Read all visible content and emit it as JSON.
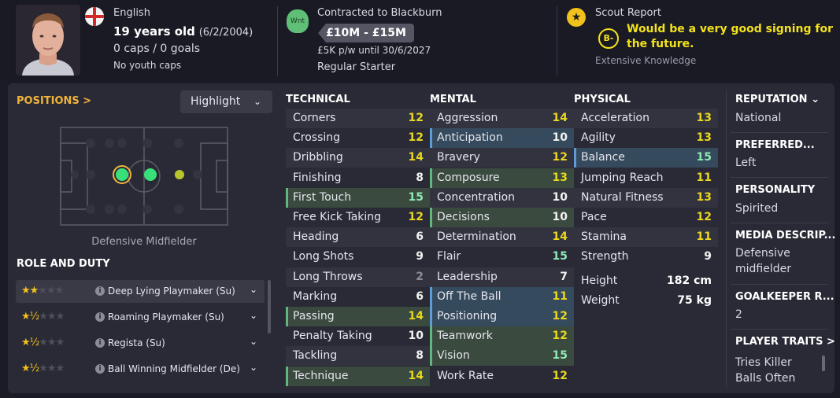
{
  "header": {
    "nationality": "English",
    "age": "19 years old",
    "dob": "(6/2/2004)",
    "caps": "0 caps / 0 goals",
    "youth_caps": "No youth caps",
    "wnt_badge": "Wnt",
    "contract": "Contracted to Blackburn",
    "value": "£10M - £15M",
    "wage": "£5K p/w until 30/6/2027",
    "squad_status": "Regular Starter",
    "scout_title": "Scout Report",
    "scout_grade": "B-",
    "scout_text": "Would be a very good signing for the future.",
    "scout_knowledge": "Extensive Knowledge"
  },
  "positions": {
    "link_label": "POSITIONS >",
    "view_select": "Highlight",
    "position_name": "Defensive Midfielder"
  },
  "roles": {
    "title": "ROLE AND DUTY",
    "items": [
      {
        "label": "Deep Lying Playmaker (Su)",
        "stars": 2,
        "selected": true
      },
      {
        "label": "Roaming Playmaker (Su)",
        "stars": 1.5,
        "selected": false
      },
      {
        "label": "Regista (Su)",
        "stars": 1.5,
        "selected": false
      },
      {
        "label": "Ball Winning Midfielder (De)",
        "stars": 1.5,
        "selected": false
      }
    ]
  },
  "technical": {
    "title": "TECHNICAL",
    "items": [
      {
        "name": "Corners",
        "value": "12"
      },
      {
        "name": "Crossing",
        "value": "12"
      },
      {
        "name": "Dribbling",
        "value": "14"
      },
      {
        "name": "Finishing",
        "value": "8"
      },
      {
        "name": "First Touch",
        "value": "15"
      },
      {
        "name": "Free Kick Taking",
        "value": "12"
      },
      {
        "name": "Heading",
        "value": "6"
      },
      {
        "name": "Long Shots",
        "value": "9"
      },
      {
        "name": "Long Throws",
        "value": "2"
      },
      {
        "name": "Marking",
        "value": "6"
      },
      {
        "name": "Passing",
        "value": "14"
      },
      {
        "name": "Penalty Taking",
        "value": "10"
      },
      {
        "name": "Tackling",
        "value": "8"
      },
      {
        "name": "Technique",
        "value": "14"
      }
    ]
  },
  "mental": {
    "title": "MENTAL",
    "items": [
      {
        "name": "Aggression",
        "value": "14"
      },
      {
        "name": "Anticipation",
        "value": "10"
      },
      {
        "name": "Bravery",
        "value": "12"
      },
      {
        "name": "Composure",
        "value": "13"
      },
      {
        "name": "Concentration",
        "value": "10"
      },
      {
        "name": "Decisions",
        "value": "10"
      },
      {
        "name": "Determination",
        "value": "14"
      },
      {
        "name": "Flair",
        "value": "15"
      },
      {
        "name": "Leadership",
        "value": "7"
      },
      {
        "name": "Off The Ball",
        "value": "11"
      },
      {
        "name": "Positioning",
        "value": "12"
      },
      {
        "name": "Teamwork",
        "value": "12"
      },
      {
        "name": "Vision",
        "value": "15"
      },
      {
        "name": "Work Rate",
        "value": "12"
      }
    ]
  },
  "physical": {
    "title": "PHYSICAL",
    "items": [
      {
        "name": "Acceleration",
        "value": "13"
      },
      {
        "name": "Agility",
        "value": "13"
      },
      {
        "name": "Balance",
        "value": "15"
      },
      {
        "name": "Jumping Reach",
        "value": "11"
      },
      {
        "name": "Natural Fitness",
        "value": "13"
      },
      {
        "name": "Pace",
        "value": "12"
      },
      {
        "name": "Stamina",
        "value": "11"
      },
      {
        "name": "Strength",
        "value": "9"
      }
    ],
    "height_label": "Height",
    "height": "182 cm",
    "weight_label": "Weight",
    "weight": "75 kg"
  },
  "info": {
    "reputation_title": "REPUTATION",
    "reputation": "National",
    "foot_title": "PREFERRED...",
    "foot": "Left",
    "personality_title": "PERSONALITY",
    "personality": "Spirited",
    "media_title": "MEDIA DESCRIP...",
    "media": "Defensive midfielder",
    "gk_title": "GOALKEEPER R...",
    "gk": "2",
    "traits_title": "PLAYER TRAITS >",
    "traits": "Tries Killer Balls Often"
  },
  "colors": {
    "accent_orange": "#f0b43a",
    "value_yellow": "#e9d81d",
    "value_green": "#8ee8b4",
    "highlight_green": "#63b57e",
    "highlight_blue": "#5f9bd6",
    "star_gold": "#f2c11c"
  }
}
